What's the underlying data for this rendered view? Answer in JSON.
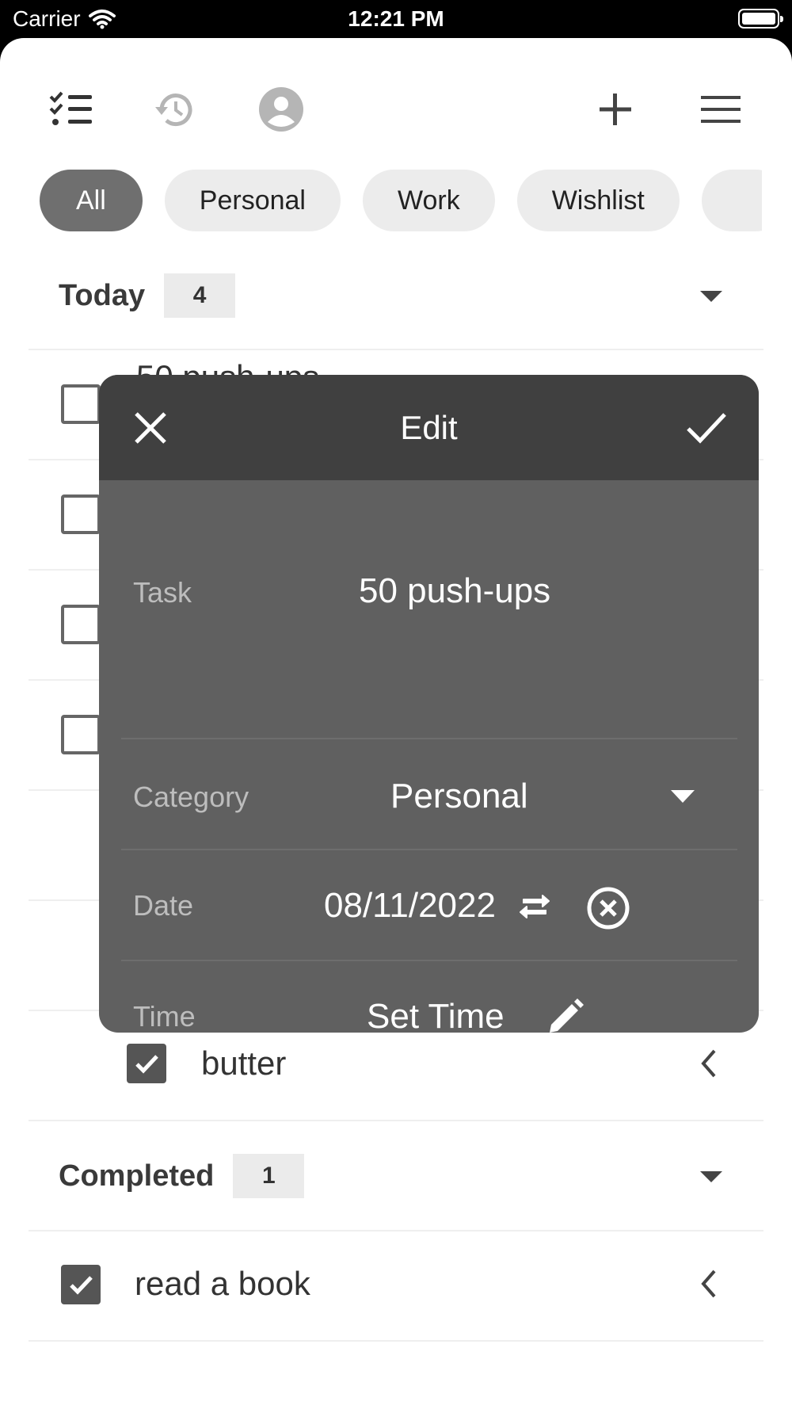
{
  "status_bar": {
    "carrier": "Carrier",
    "time": "12:21 PM"
  },
  "toolbar": {
    "icons": [
      "checklist-icon",
      "history-icon",
      "account-icon",
      "plus-icon",
      "menu-icon"
    ]
  },
  "categories": [
    {
      "label": "All",
      "active": true
    },
    {
      "label": "Personal"
    },
    {
      "label": "Work"
    },
    {
      "label": "Wishlist"
    }
  ],
  "today": {
    "title": "Today",
    "count": "4",
    "partial_item_text": "50 push-ups",
    "visible_item": {
      "text": "butter",
      "checked": true
    }
  },
  "completed": {
    "title": "Completed",
    "count": "1",
    "items": [
      {
        "text": "read a book",
        "checked": true
      }
    ]
  },
  "dialog": {
    "title": "Edit",
    "task_label": "Task",
    "task_value": "50 push-ups",
    "category_label": "Category",
    "category_value": "Personal",
    "date_label": "Date",
    "date_value": "08/11/2022",
    "time_label": "Time",
    "time_value": "Set Time"
  },
  "colors": {
    "dialog_body": "#606060",
    "dialog_header": "#404040",
    "active_chip": "#6f6f6f",
    "chip": "#ececec"
  }
}
